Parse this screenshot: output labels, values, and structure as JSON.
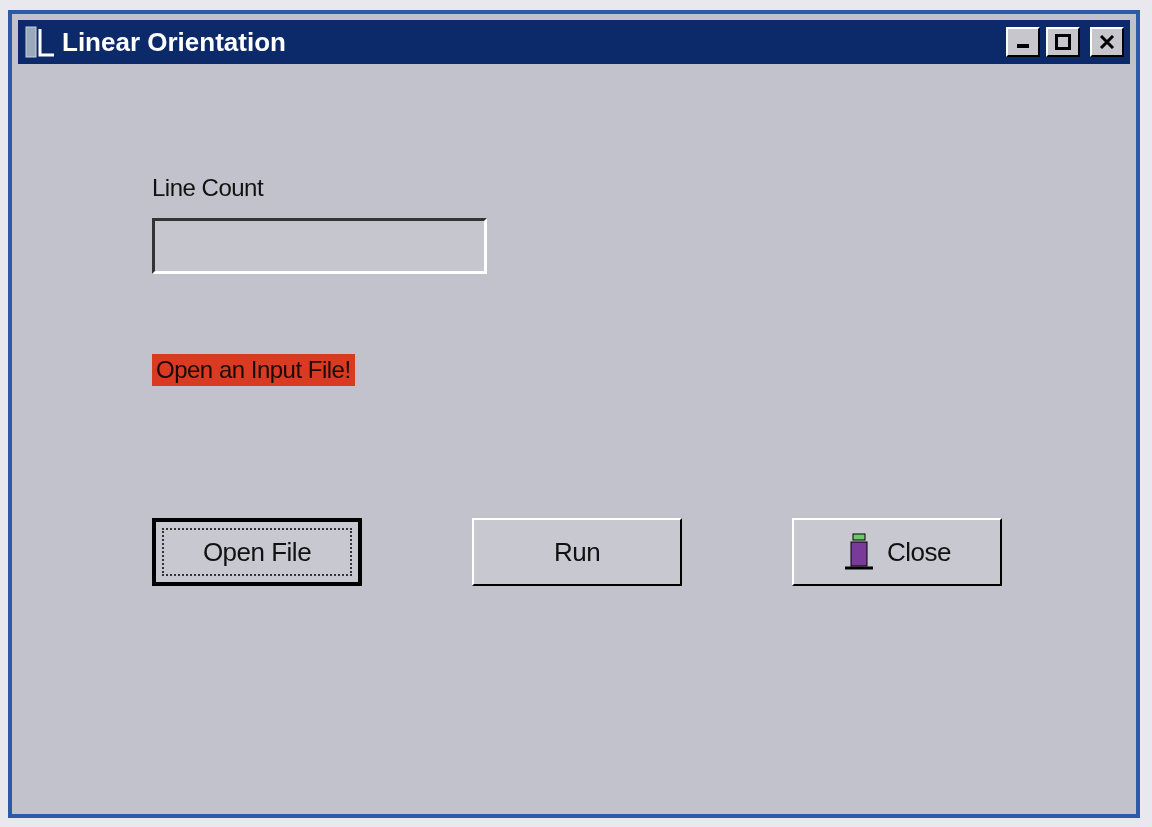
{
  "window": {
    "title": "Linear Orientation"
  },
  "line_count": {
    "label": "Line Count"
  },
  "status": {
    "text": "Open an Input File!",
    "color": "#d83a22"
  },
  "buttons": [
    {
      "label": "Open File",
      "focused": true,
      "icon": false
    },
    {
      "label": "Run",
      "focused": false,
      "icon": false
    },
    {
      "label": "Close",
      "focused": false,
      "icon": true
    }
  ]
}
